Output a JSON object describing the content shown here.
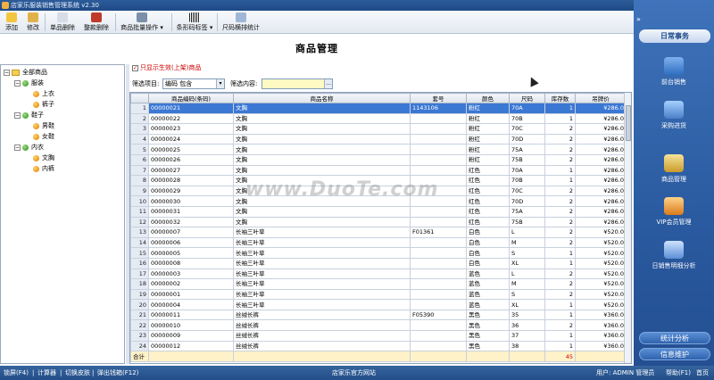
{
  "window": {
    "title": "店家乐服装销售管理系统 v2.30"
  },
  "toolbar": {
    "add": "添加",
    "edit": "修改",
    "delete_one": "单品删除",
    "delete_all": "整款删除",
    "batch": "商品批量操作",
    "barcode": "条形码标签",
    "size_stats": "尺码横排统计"
  },
  "page": {
    "title": "商品管理"
  },
  "filters": {
    "only_active_label": "只显示生效(上架)商品",
    "item_label": "筛选项目:",
    "item_value": "编码 包含",
    "content_label": "筛选内容:",
    "content_value": ""
  },
  "tree": {
    "root": "全部商品",
    "cat1": "服装",
    "cat1_a": "上衣",
    "cat1_b": "裤子",
    "cat2": "鞋子",
    "cat2_a": "男鞋",
    "cat2_b": "女鞋",
    "cat3": "内衣",
    "cat3_a": "文胸",
    "cat3_b": "内裤"
  },
  "table": {
    "headers": [
      "",
      "商品编码(条码)",
      "商品名称",
      "套号",
      "颜色",
      "尺码",
      "库存数",
      "吊牌价"
    ],
    "rows": [
      [
        "1",
        "00000021",
        "文胸",
        "1143106",
        "粉红",
        "70A",
        "1",
        "¥286.0"
      ],
      [
        "2",
        "00000022",
        "文胸",
        "",
        "粉红",
        "70B",
        "1",
        "¥286.0"
      ],
      [
        "3",
        "00000023",
        "文胸",
        "",
        "粉红",
        "70C",
        "2",
        "¥286.0"
      ],
      [
        "4",
        "00000024",
        "文胸",
        "",
        "粉红",
        "70D",
        "2",
        "¥286.0"
      ],
      [
        "5",
        "00000025",
        "文胸",
        "",
        "粉红",
        "75A",
        "2",
        "¥286.0"
      ],
      [
        "6",
        "00000026",
        "文胸",
        "",
        "粉红",
        "75B",
        "2",
        "¥286.0"
      ],
      [
        "7",
        "00000027",
        "文胸",
        "",
        "红色",
        "70A",
        "1",
        "¥286.0"
      ],
      [
        "8",
        "00000028",
        "文胸",
        "",
        "红色",
        "70B",
        "1",
        "¥286.0"
      ],
      [
        "9",
        "00000029",
        "文胸",
        "",
        "红色",
        "70C",
        "2",
        "¥286.0"
      ],
      [
        "10",
        "00000030",
        "文胸",
        "",
        "红色",
        "70D",
        "2",
        "¥286.0"
      ],
      [
        "11",
        "00000031",
        "文胸",
        "",
        "红色",
        "75A",
        "2",
        "¥286.0"
      ],
      [
        "12",
        "00000032",
        "文胸",
        "",
        "红色",
        "75B",
        "2",
        "¥286.0"
      ],
      [
        "13",
        "00000007",
        "长袖三叶草",
        "F01361",
        "白色",
        "L",
        "2",
        "¥520.0"
      ],
      [
        "14",
        "00000006",
        "长袖三叶草",
        "",
        "白色",
        "M",
        "2",
        "¥520.0"
      ],
      [
        "15",
        "00000005",
        "长袖三叶草",
        "",
        "白色",
        "S",
        "1",
        "¥520.0"
      ],
      [
        "16",
        "00000008",
        "长袖三叶草",
        "",
        "白色",
        "XL",
        "1",
        "¥520.0"
      ],
      [
        "17",
        "00000003",
        "长袖三叶草",
        "",
        "蓝色",
        "L",
        "2",
        "¥520.0"
      ],
      [
        "18",
        "00000002",
        "长袖三叶草",
        "",
        "蓝色",
        "M",
        "2",
        "¥520.0"
      ],
      [
        "19",
        "00000001",
        "长袖三叶草",
        "",
        "蓝色",
        "S",
        "2",
        "¥520.0"
      ],
      [
        "20",
        "00000004",
        "长袖三叶草",
        "",
        "蓝色",
        "XL",
        "1",
        "¥520.0"
      ],
      [
        "21",
        "00000011",
        "丝绒长裤",
        "F05390",
        "黑色",
        "35",
        "1",
        "¥360.0"
      ],
      [
        "22",
        "00000010",
        "丝绒长裤",
        "",
        "黑色",
        "36",
        "2",
        "¥360.0"
      ],
      [
        "23",
        "00000009",
        "丝绒长裤",
        "",
        "黑色",
        "37",
        "1",
        "¥360.0"
      ],
      [
        "24",
        "00000012",
        "丝绒长裤",
        "",
        "黑色",
        "38",
        "1",
        "¥360.0"
      ]
    ],
    "total_label": "合计",
    "total_stock": "45"
  },
  "side": {
    "header": "日常事务",
    "items": [
      "前台销售",
      "采购进货",
      "商品管理",
      "VIP会员管理",
      "日销售明细分析"
    ],
    "btn1": "统计分析",
    "btn2": "信息维护"
  },
  "status": {
    "lock": "锁屏(F4)",
    "calc": "计算器",
    "skin": "切换皮肤",
    "drawer": "弹出钱箱(F12)",
    "site": "店家乐官方网站",
    "user": "用户: ADMIN 管理员",
    "help": "帮助(F1)",
    "home": "首页"
  },
  "watermark": "www.DuoTe.com",
  "colors": {
    "selected_row": "#3b78d4",
    "sidebar": "#2a5aa0",
    "total_row": "#fff2c8"
  }
}
